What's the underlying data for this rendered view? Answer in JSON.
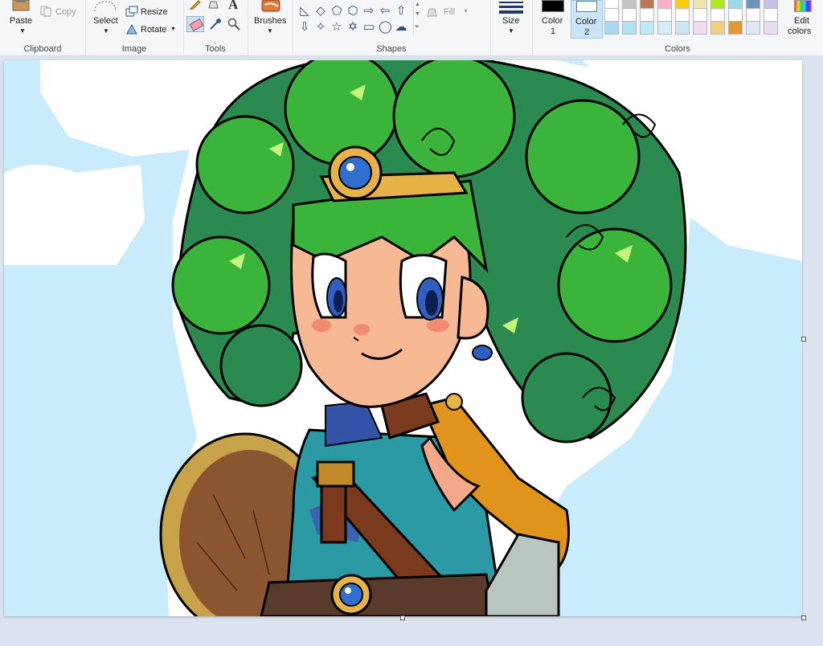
{
  "ribbon": {
    "clipboard": {
      "label": "Clipboard",
      "paste": "Paste",
      "copy": "Copy"
    },
    "image": {
      "label": "Image",
      "select": "Select",
      "resize": "Resize",
      "rotate": "Rotate"
    },
    "tools": {
      "label": "Tools",
      "text_glyph": "A"
    },
    "brushes": {
      "label": "Brushes"
    },
    "shapes": {
      "label": "Shapes",
      "fill": "Fill"
    },
    "size": {
      "label": "Size"
    },
    "colors": {
      "label": "Colors",
      "color1_line1": "Color",
      "color1_line2": "1",
      "color2_line1": "Color",
      "color2_line2": "2",
      "edit_line1": "Edit",
      "edit_line2": "colors",
      "color1_value": "#000000",
      "color2_value": "#ffffff",
      "palette_row1": [
        "#ffffff",
        "#c3c3c3",
        "#b97a57",
        "#ffaec9",
        "#ffc90e",
        "#efe4b0",
        "#b5e61d",
        "#99d9ea",
        "#7092be",
        "#c8bfe7"
      ],
      "palette_row2": [
        "#ffffff",
        "#ffffff",
        "#ffffff",
        "#ffffff",
        "#ffffff",
        "#ffffff",
        "#ffffff",
        "#ffffff",
        "#ffffff",
        "#ffffff"
      ],
      "palette_row3": [
        "#aad8f0",
        "#b4e0f4",
        "#bfe8f8",
        "#d7ecfb",
        "#cfe5f5",
        "#f1dbee",
        "#f0d080",
        "#e09a30",
        "#dfe8f4",
        "#e6ddf3"
      ]
    }
  },
  "icons": {
    "paste": "clipboard-icon",
    "copy": "copy-icon",
    "select": "select-icon",
    "resize": "resize-icon",
    "rotate": "rotate-icon",
    "pencil": "pencil-icon",
    "fill": "fill-bucket-icon",
    "text": "text-icon",
    "eraser": "eraser-icon",
    "picker": "color-picker-icon",
    "magnifier": "magnifier-icon",
    "brush": "brush-icon",
    "size": "line-size-icon"
  }
}
